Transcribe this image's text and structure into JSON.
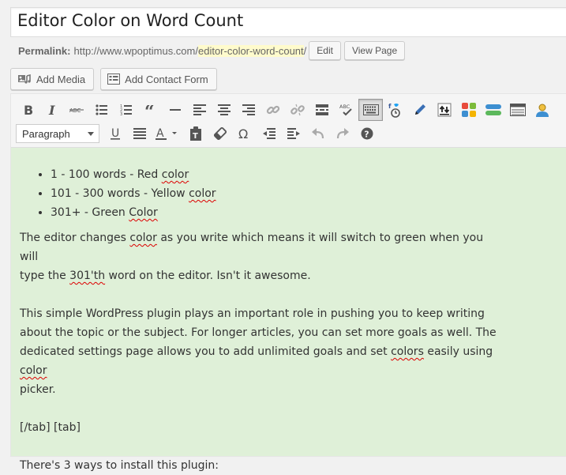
{
  "post": {
    "title": "Editor Color on Word Count"
  },
  "permalink": {
    "label": "Permalink:",
    "base": "http://www.wpoptimus.com/",
    "slug": "editor-color-word-count",
    "suffix": "/",
    "edit_label": "Edit",
    "view_label": "View Page"
  },
  "media": {
    "add_media": "Add Media",
    "add_contact_form": "Add Contact Form"
  },
  "toolbar": {
    "format_select": "Paragraph",
    "icons_row1": [
      "bold-icon",
      "italic-icon",
      "strikethrough-icon",
      "bullet-list-icon",
      "numbered-list-icon",
      "blockquote-icon",
      "horizontal-rule-icon",
      "align-left-icon",
      "align-center-icon",
      "align-right-icon",
      "insert-link-icon",
      "remove-link-icon",
      "read-more-icon",
      "spellcheck-icon",
      "toolbar-toggle-icon",
      "social-icon",
      "pen-icon",
      "upload-icon",
      "tiles-icon",
      "stack-icon",
      "table-icon",
      "user-icon"
    ],
    "icons_row2": [
      "underline-icon",
      "justify-icon",
      "text-color-icon",
      "paste-text-icon",
      "clear-formatting-icon",
      "special-character-icon",
      "outdent-icon",
      "indent-icon",
      "undo-icon",
      "redo-icon",
      "help-icon"
    ],
    "accent": "#dff0d8"
  },
  "content": {
    "list": [
      {
        "pre": "1 - 100 words - Red ",
        "sp": "color",
        "post": ""
      },
      {
        "pre": "101 - 300 words - Yellow ",
        "sp": "color",
        "post": ""
      },
      {
        "pre": "301+ - Green ",
        "sp": "Color",
        "post": ""
      }
    ],
    "p1_a": "The editor changes ",
    "p1_sp1": "color",
    "p1_b": " as you write which means it will switch to green when you will",
    "p1_c": "type the ",
    "p1_sp2": "301'th",
    "p1_d": " word on the editor. Isn't it awesome.",
    "p2_a": "This simple WordPress plugin plays an important role in pushing you to keep writing",
    "p2_b": "about the topic or the subject. For longer articles, you can set more goals as well. The",
    "p2_c": "dedicated settings page allows you to add unlimited goals and set ",
    "p2_sp1": "colors",
    "p2_d": " easily using ",
    "p2_sp2": "color",
    "p2_e": "picker.",
    "p3": "[/tab] [tab]",
    "p4": "There's 3 ways to install this plugin:"
  }
}
